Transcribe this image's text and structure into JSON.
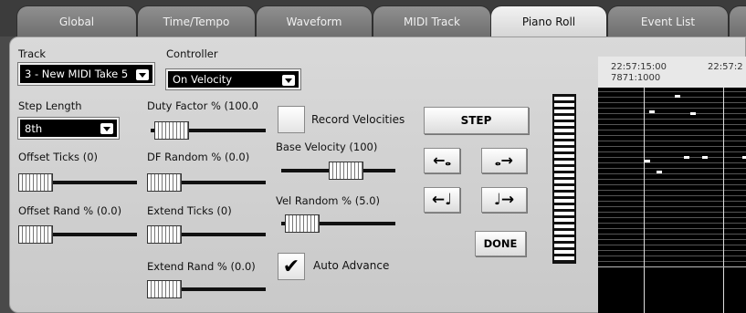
{
  "tabs": [
    "Global",
    "Time/Tempo",
    "Waveform",
    "MIDI Track",
    "Piano Roll",
    "Event List",
    ""
  ],
  "active_tab": "Piano Roll",
  "track": {
    "label": "Track",
    "value": "3 - New MIDI Take 5"
  },
  "controller": {
    "label": "Controller",
    "value": "On Velocity"
  },
  "step_length": {
    "label": "Step Length",
    "value": "8th"
  },
  "sliders": {
    "duty_factor": {
      "label": "Duty Factor % (100.0",
      "level": 0.05
    },
    "offset_ticks": {
      "label": "Offset Ticks (0)",
      "level": 0.0
    },
    "df_random": {
      "label": "DF Random % (0.0)",
      "level": 0.0
    },
    "base_velocity": {
      "label": "Base Velocity (100)",
      "level": 0.6
    },
    "offset_rand": {
      "label": "Offset Rand % (0.0)",
      "level": 0.0
    },
    "extend_ticks": {
      "label": "Extend Ticks (0)",
      "level": 0.0
    },
    "vel_random": {
      "label": "Vel Random % (5.0)",
      "level": 0.05
    },
    "extend_rand": {
      "label": "Extend Rand % (0.0)",
      "level": 0.0
    }
  },
  "record_velocities": {
    "label": "Record Velocities",
    "checked": false
  },
  "auto_advance": {
    "label": "Auto Advance",
    "checked": true,
    "check_glyph": "✔"
  },
  "buttons": {
    "step": "STEP",
    "done": "DONE",
    "rest_back": "←𝅝",
    "rest_fwd": "𝅝→",
    "note_back": "←♩",
    "note_fwd": "♩→"
  },
  "roll": {
    "time1": "22:57:15:00",
    "time2": "22:57:2",
    "bars": "7871:1000"
  }
}
